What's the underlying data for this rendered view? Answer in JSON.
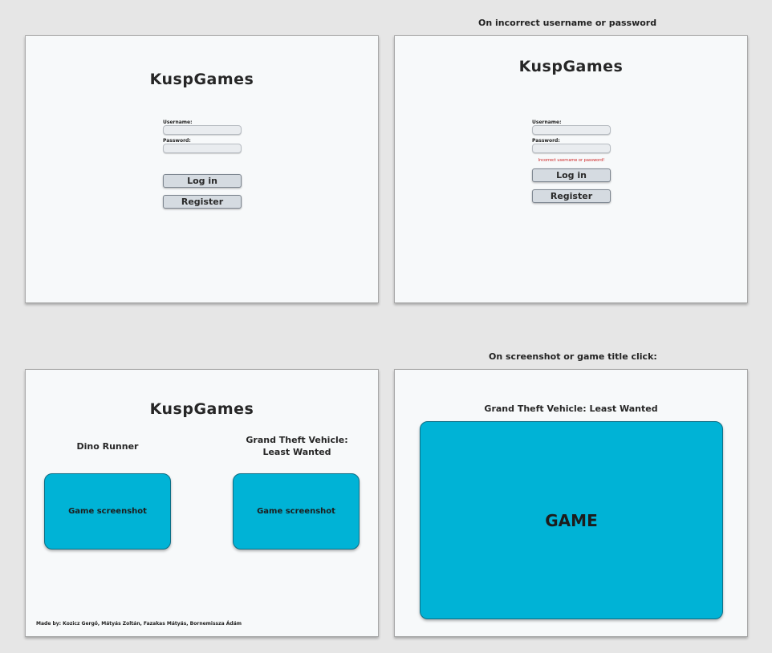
{
  "app": {
    "title": "KuspGames"
  },
  "captions": {
    "incorrect_login": "On incorrect username or password",
    "game_click": "On screenshot or game title click:"
  },
  "login": {
    "username_label": "Username:",
    "password_label": "Password:",
    "username_value": "",
    "password_value": "",
    "login_button": "Log in",
    "register_button": "Register",
    "error_message": "Incorrect username or password!"
  },
  "games": [
    {
      "title": "Dino Runner",
      "screenshot_label": "Game screenshot"
    },
    {
      "title": "Grand Theft Vehicle: Least Wanted",
      "screenshot_label": "Game screenshot"
    }
  ],
  "footer": {
    "credits": "Made by: Kozicz Gergő, Mátyás Zoltán, Fazakas Mátyás, Bornemissza Ádám"
  },
  "game_view": {
    "title": "Grand Theft Vehicle: Least Wanted",
    "game_label": "GAME"
  },
  "colors": {
    "accent": "#00b3d6",
    "error": "#cc1f1f",
    "panel": "#f7f9fa",
    "background": "#e6e6e6"
  }
}
